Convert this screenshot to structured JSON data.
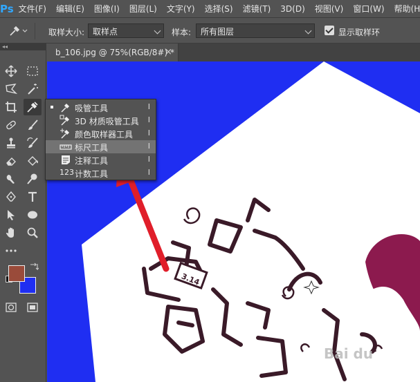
{
  "app": {
    "logo": "Ps"
  },
  "menu": [
    "文件(F)",
    "编辑(E)",
    "图像(I)",
    "图层(L)",
    "文字(Y)",
    "选择(S)",
    "滤镜(T)",
    "3D(D)",
    "视图(V)",
    "窗口(W)",
    "帮助(H)"
  ],
  "options": {
    "sample_size_label": "取样大小:",
    "sample_size_value": "取样点",
    "sample_label": "样本:",
    "sample_value": "所有图层",
    "show_ring_label": "显示取样环",
    "show_ring_checked": true
  },
  "document": {
    "tab_title": "b_106.jpg @ 75%(RGB/8#) *",
    "close_glyph": "×",
    "canvas_color": "#1f2ef2"
  },
  "toolbar": {
    "collapse_glyph": "◂◂"
  },
  "flyout": {
    "items": [
      {
        "label": "吸管工具",
        "key": "I",
        "icon": "eyedropper-icon",
        "selected": true
      },
      {
        "label": "3D 材质吸管工具",
        "key": "I",
        "icon": "3d-eyedropper-icon"
      },
      {
        "label": "颜色取样器工具",
        "key": "I",
        "icon": "color-sampler-icon"
      },
      {
        "label": "标尺工具",
        "key": "I",
        "icon": "ruler-icon",
        "highlighted": true
      },
      {
        "label": "注释工具",
        "key": "I",
        "icon": "note-icon"
      },
      {
        "label": "计数工具",
        "key": "I",
        "icon": "count-icon",
        "icon_text": "123"
      }
    ]
  },
  "artwork": {
    "label": "3.14",
    "watermark": "Bai du"
  },
  "colors": {
    "foreground": "#9a4b3a",
    "background": "#1f2ef2",
    "annotation_arrow": "#e01e2a",
    "ui_bg": "#535353"
  }
}
